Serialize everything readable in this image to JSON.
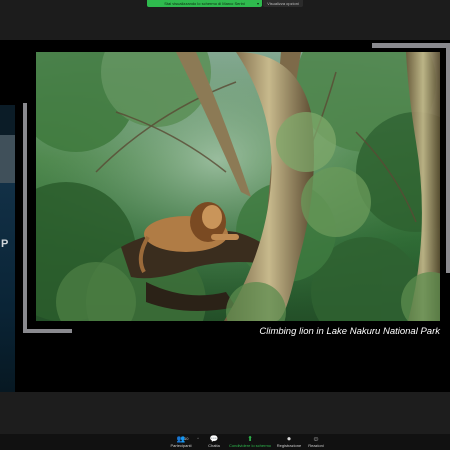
{
  "meeting": {
    "share_banner": "Stai visualizzando lo schermo di Marco Serini",
    "view_options": "Visualizza opzioni"
  },
  "presentation": {
    "caption": "Climbing lion in Lake Nakuru National Park",
    "side_panel_letter": "P"
  },
  "toolbar": {
    "items": [
      {
        "label": "Partecipanti",
        "icon": "participants-icon",
        "badge": "10"
      },
      {
        "label": "Chatta",
        "icon": "chat-icon"
      },
      {
        "label": "Condividere lo schermo",
        "icon": "share-screen-icon"
      },
      {
        "label": "Registrazione",
        "icon": "record-icon"
      },
      {
        "label": "Reazioni",
        "icon": "reactions-icon"
      }
    ]
  },
  "colors": {
    "accent_green": "#2fba4e",
    "background": "#1f1f1f",
    "share_area": "#000000"
  }
}
